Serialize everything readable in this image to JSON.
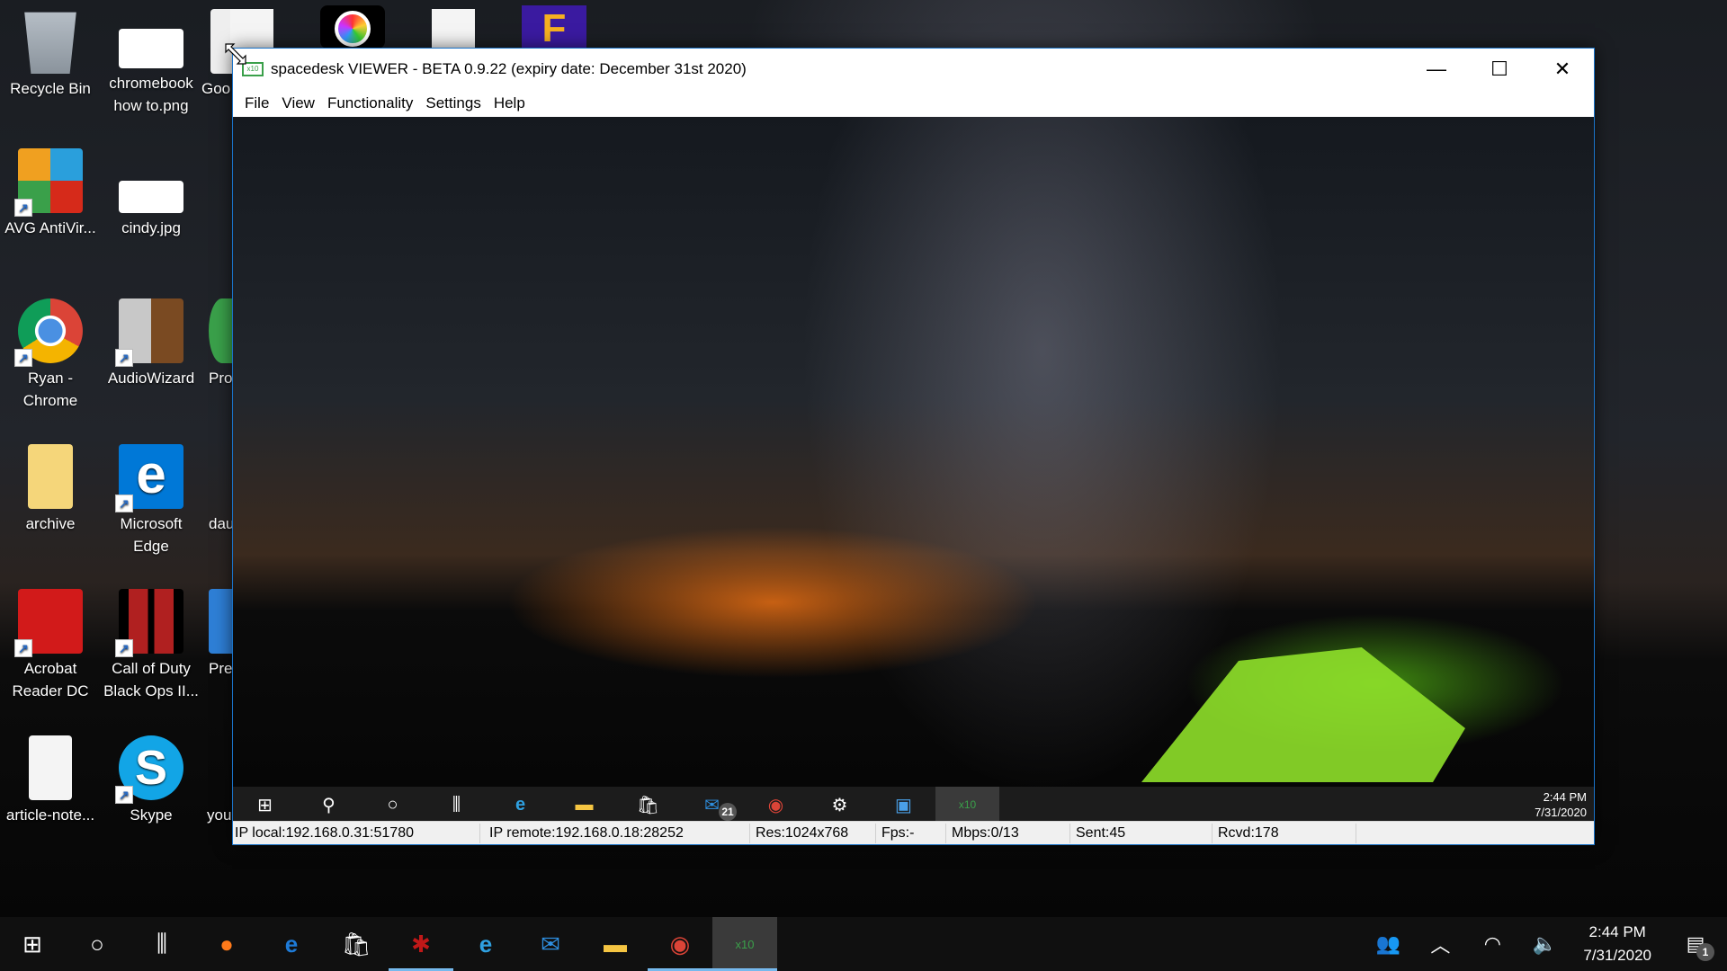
{
  "desktop": {
    "icons": [
      {
        "label": "Recycle Bin",
        "icon": "recycle-bin-icon",
        "color": "#9aa3ad"
      },
      {
        "label": "chromebook how to.png",
        "icon": "image-file-icon",
        "color": "#ffffff"
      },
      {
        "label": "AVG AntiVir...",
        "icon": "avg-antivirus-icon",
        "color": "#e05a1e"
      },
      {
        "label": "cindy.jpg",
        "icon": "image-file-icon",
        "color": "#ffffff"
      },
      {
        "label": "Ryan - Chrome",
        "icon": "chrome-icon",
        "color": "#4285f4"
      },
      {
        "label": "AudioWizard",
        "icon": "speaker-icon",
        "color": "#8a5a2e"
      },
      {
        "label": "archive",
        "icon": "folder-icon",
        "color": "#f5d67a"
      },
      {
        "label": "Microsoft Edge",
        "icon": "edge-icon",
        "color": "#0078d7"
      },
      {
        "label": "Acrobat Reader DC",
        "icon": "acrobat-icon",
        "color": "#d21a1a"
      },
      {
        "label": "Call of Duty Black Ops II...",
        "icon": "game-icon",
        "color": "#2a0a0a"
      },
      {
        "label": "article-note...",
        "icon": "text-file-icon",
        "color": "#ffffff"
      },
      {
        "label": "Skype",
        "icon": "skype-icon",
        "color": "#12a5e6"
      },
      {
        "label": "Goo",
        "icon": "shortcut-icon",
        "color": "#dddddd"
      },
      {
        "label": "Pro",
        "icon": "shortcut-icon",
        "color": "#3aa04a"
      },
      {
        "label": "dau",
        "icon": "shortcut-icon",
        "color": "#cccccc"
      },
      {
        "label": "Pre",
        "icon": "shortcut-icon",
        "color": "#2e7fd6"
      },
      {
        "label": "you",
        "icon": "shortcut-icon",
        "color": "#cccccc"
      }
    ]
  },
  "window": {
    "title": "spacedesk VIEWER - BETA 0.9.22 (expiry date: December 31st 2020)",
    "app_icon_text": "x10",
    "controls": {
      "minimize": "—",
      "maximize": "☐",
      "close": "✕"
    },
    "menu": [
      "File",
      "View",
      "Functionality",
      "Settings",
      "Help"
    ],
    "remote_taskbar": {
      "items": [
        "windows-start",
        "search",
        "cortana",
        "task-view",
        "edge",
        "file-explorer",
        "store",
        "mail",
        "chrome",
        "settings",
        "remote-desktop",
        "spacedesk"
      ],
      "mail_badge": "21",
      "time": "2:44 PM",
      "date": "7/31/2020"
    },
    "status": {
      "ip_local": "IP local:192.168.0.31:51780",
      "ip_remote": "IP remote:192.168.0.18:28252",
      "res": "Res:1024x768",
      "fps": "Fps:-",
      "mbps": "Mbps:0/13",
      "sent": "Sent:45",
      "rcvd": "Rcvd:178"
    }
  },
  "taskbar": {
    "items": [
      "windows-start",
      "cortana",
      "task-view",
      "firefox",
      "edge",
      "store",
      "unknown-red-app",
      "internet-explorer",
      "mail",
      "file-explorer",
      "chrome",
      "spacedesk"
    ],
    "time": "2:44 PM",
    "date": "7/31/2020",
    "notification_count": "1"
  }
}
